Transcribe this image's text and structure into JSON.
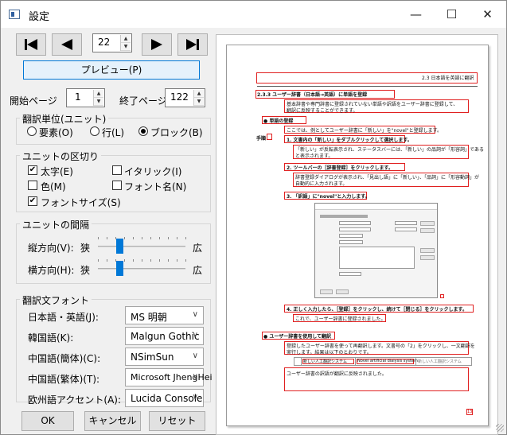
{
  "window": {
    "title": "設定",
    "minimize_glyph": "—",
    "maximize_glyph": "☐",
    "close_glyph": "✕"
  },
  "nav": {
    "page_value": "22",
    "preview_label": "プレビュー(P)"
  },
  "page_range": {
    "start_label": "開始ページ",
    "start_value": "1",
    "end_label": "終了ページ",
    "end_value": "122"
  },
  "unit": {
    "title": "翻訳単位(ユニット)",
    "options": [
      {
        "label": "要素(O)",
        "selected": false
      },
      {
        "label": "行(L)",
        "selected": false
      },
      {
        "label": "ブロック(B)",
        "selected": true
      }
    ]
  },
  "separators": {
    "title": "ユニットの区切り",
    "items": [
      {
        "label": "太字(E)",
        "checked": true
      },
      {
        "label": "イタリック(I)",
        "checked": false
      },
      {
        "label": "色(M)",
        "checked": false
      },
      {
        "label": "フォント名(N)",
        "checked": false
      },
      {
        "label": "フォントサイズ(S)",
        "checked": true
      }
    ]
  },
  "spacing": {
    "title": "ユニットの間隔",
    "vertical_label": "縦方向(V):",
    "horizontal_label": "横方向(H):",
    "narrow": "狭",
    "wide": "広",
    "vertical_level": 0.25,
    "horizontal_level": 0.25
  },
  "fonts": {
    "title": "翻訳文フォント",
    "rows": [
      {
        "label": "日本語・英語(J):",
        "value": "MS 明朝"
      },
      {
        "label": "韓国語(K):",
        "value": "Malgun Gothic"
      },
      {
        "label": "中国語(簡体)(C):",
        "value": "NSimSun"
      },
      {
        "label": "中国語(繁体)(T):",
        "value": "Microsoft JhengHei"
      },
      {
        "label": "欧州語アクセント(A):",
        "value": "Lucida Console"
      }
    ]
  },
  "buttons": {
    "ok": "OK",
    "cancel": "キャンセル",
    "reset": "リセット"
  },
  "document": {
    "header": "2.3 日本語を英語に翻訳",
    "section": "2.3.3 ユーザー辞書（日本語→英語）に単語を登録",
    "intro_1": "基本辞書や専門辞書に登録されていない単語や訳語をユーザー辞書に登録して、",
    "intro_2": "翻訳に反映することができます。",
    "bullet_1": "● 単語の登録",
    "example": "ここでは、例としてユーザー辞書に「新しい」を\"novel\"と登録します。",
    "side_label": "手順",
    "step_1": "1. 文書内の「新しい」をダブルクリックして選択します。",
    "step_1_note_1": "「新しい」が反転表示され、ステータスバーには、「新しい」の品詞が「形容詞」である",
    "step_1_note_2": "と表示されます。",
    "step_2": "2. ツールバーの［辞書登録］をクリックします。",
    "step_2_note_1": "辞書登録ダイアログが表示され、「見出し語」に「新しい」、「品詞」に「形容動詞」が",
    "step_2_note_2": "自動的に入力されます。",
    "step_3": "3. 「訳語」に\"novel\"と入力します。",
    "step_4": "4. 正しく入力したら、［登録］をクリックし、続けて［閉じる］をクリックします。",
    "step_4_note": "これで、ユーザー辞書に登録されました。",
    "bullet_2": "● ユーザー辞書を使用して翻訳",
    "use_1": "登録したユーザー辞書を使って再翻訳します。文書号の「2」をクリックし、一文翻訳を",
    "use_2": "実行します。結果は以下のとおりです。",
    "table_a": "新しい人工翻訳システム",
    "table_b": "Novel artificial dialysis system",
    "table_c": "新しい人工翻訳システム",
    "result": "ユーザー辞書の訳語が翻訳に反映されました。",
    "page_number": "13"
  }
}
